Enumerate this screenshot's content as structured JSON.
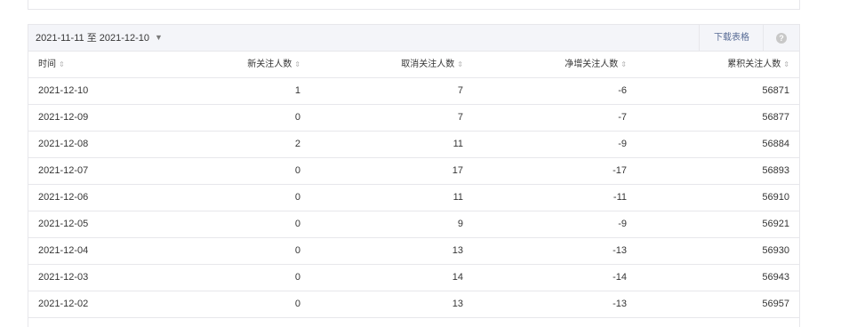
{
  "toolbar": {
    "date_range": "2021-11-11 至 2021-12-10",
    "download_label": "下载表格",
    "help_glyph": "?"
  },
  "icons": {
    "caret": "▼",
    "sort": "⇕"
  },
  "colors": {
    "link": "#576b95",
    "header_bg": "#f4f5f9",
    "border": "#e7e7eb"
  },
  "table": {
    "columns": [
      "时间",
      "新关注人数",
      "取消关注人数",
      "净增关注人数",
      "累积关注人数"
    ],
    "rows": [
      [
        "2021-12-10",
        "1",
        "7",
        "-6",
        "56871"
      ],
      [
        "2021-12-09",
        "0",
        "7",
        "-7",
        "56877"
      ],
      [
        "2021-12-08",
        "2",
        "11",
        "-9",
        "56884"
      ],
      [
        "2021-12-07",
        "0",
        "17",
        "-17",
        "56893"
      ],
      [
        "2021-12-06",
        "0",
        "11",
        "-11",
        "56910"
      ],
      [
        "2021-12-05",
        "0",
        "9",
        "-9",
        "56921"
      ],
      [
        "2021-12-04",
        "0",
        "13",
        "-13",
        "56930"
      ],
      [
        "2021-12-03",
        "0",
        "14",
        "-14",
        "56943"
      ],
      [
        "2021-12-02",
        "0",
        "13",
        "-13",
        "56957"
      ]
    ]
  }
}
